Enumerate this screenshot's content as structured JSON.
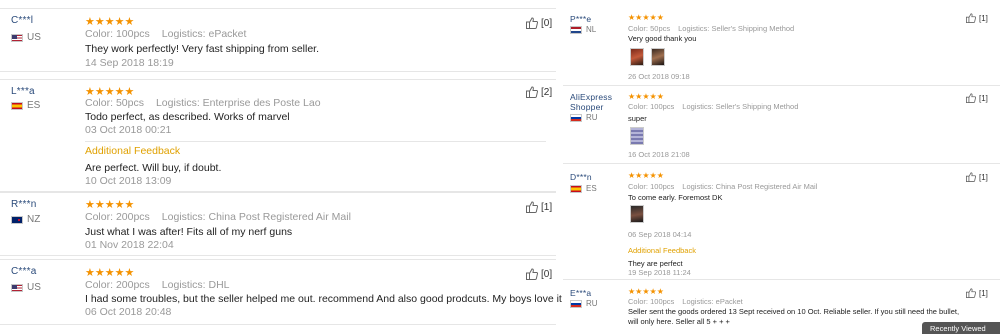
{
  "left_reviews": [
    {
      "user": "C***l",
      "country": "US",
      "stars": "★★★★★",
      "color_label": "Color:",
      "color": "100pcs",
      "logistics_label": "Logistics:",
      "logistics": "ePacket",
      "text": "They work perfectly! Very fast shipping from seller.",
      "date": "14 Sep 2018 18:19",
      "helpful": "[0]"
    },
    {
      "user": "L***a",
      "country": "ES",
      "stars": "★★★★★",
      "color_label": "Color:",
      "color": "50pcs",
      "logistics_label": "Logistics:",
      "logistics": "Enterprise des Poste Lao",
      "text": "Todo perfect, as described. Works of marvel",
      "date": "03 Oct 2018 00:21",
      "helpful": "[2]",
      "additional_label": "Additional Feedback",
      "additional_text": "Are perfect. Will buy, if doubt.",
      "additional_date": "10 Oct 2018 13:09"
    },
    {
      "user": "R***n",
      "country": "NZ",
      "stars": "★★★★★",
      "color_label": "Color:",
      "color": "200pcs",
      "logistics_label": "Logistics:",
      "logistics": "China Post Registered Air Mail",
      "text": "Just what I was after! Fits all of my nerf guns",
      "date": "01 Nov 2018 22:04",
      "helpful": "[1]"
    },
    {
      "user": "C***a",
      "country": "US",
      "stars": "★★★★★",
      "color_label": "Color:",
      "color": "200pcs",
      "logistics_label": "Logistics:",
      "logistics": "DHL",
      "text": "I had some troubles, but the seller helped me out. recommend And also good prodcuts. My boys love it",
      "date": "06 Oct 2018 20:48",
      "helpful": "[0]"
    }
  ],
  "right_reviews": [
    {
      "user": "P***e",
      "country": "NL",
      "stars": "★★★★★",
      "color_label": "Color:",
      "color": "50pcs",
      "logistics_label": "Logistics:",
      "logistics": "Seller's Shipping Method",
      "text": "Very good thank you",
      "date": "26 Oct 2018 09:18",
      "helpful": "[1]"
    },
    {
      "user": "AliExpress Shopper",
      "country": "RU",
      "stars": "★★★★★",
      "color_label": "Color:",
      "color": "100pcs",
      "logistics_label": "Logistics:",
      "logistics": "Seller's Shipping Method",
      "text": "super",
      "date": "16 Oct 2018 21:08",
      "helpful": "[1]"
    },
    {
      "user": "D***n",
      "country": "ES",
      "stars": "★★★★★",
      "color_label": "Color:",
      "color": "100pcs",
      "logistics_label": "Logistics:",
      "logistics": "China Post Registered Air Mail",
      "text": "To come early. Foremost DK",
      "date": "06 Sep 2018 04:14",
      "helpful": "[1]",
      "additional_label": "Additional Feedback",
      "additional_text": "They are perfect",
      "additional_date": "19 Sep 2018 11:24"
    },
    {
      "user": "E***a",
      "country": "RU",
      "stars": "★★★★★",
      "color_label": "Color:",
      "color": "100pcs",
      "logistics_label": "Logistics:",
      "logistics": "ePacket",
      "text": "Seller sent the goods ordered 13 Sept received on 10 Oct. Reliable seller. If you still need the bullet, will only here. Seller all 5 + + +",
      "helpful": "[1]"
    }
  ],
  "recently_viewed": "Recently Viewed",
  "colors": {
    "stars": "#f49200",
    "additional": "#e0a100",
    "username": "#2a4a7a"
  },
  "icons": {
    "helpful": "thumbs-up-icon",
    "flag": "flag-icon",
    "photo": "review-photo"
  }
}
